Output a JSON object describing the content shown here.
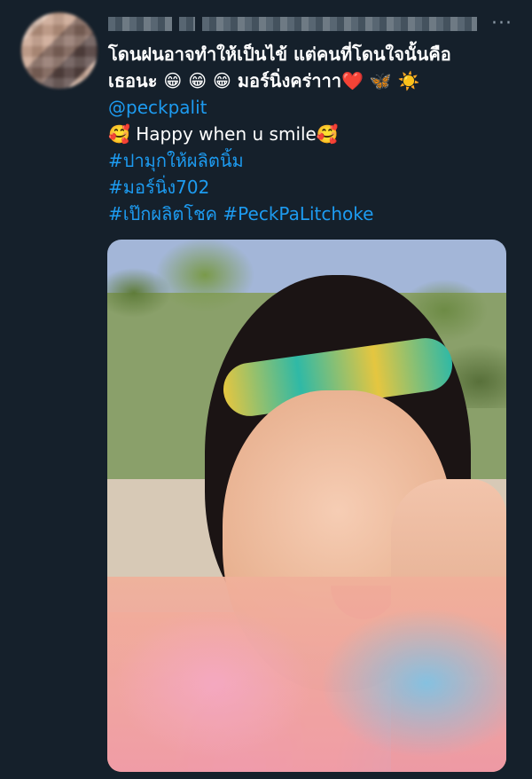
{
  "tweet": {
    "more": "···",
    "text": {
      "line1": "โดนฝนอาจทำให้เป็นไข้ แต่คนที่โดนใจนั้นคือ",
      "line2": "เธอนะ 😁 😁 😁 มอร์นิ่งคร่าาา❤️ 🦋 ☀️",
      "mention": "@peckpalit",
      "happy": "🥰 Happy when u smile🥰",
      "hashtag1": "#ปามุกให้ผลิตนิ้ม",
      "hashtag2": "#มอร์นิ่ง702",
      "hashtag3": "#เป๊กผลิตโชค #PeckPaLitchoke"
    }
  },
  "colors": {
    "background": "#15202b",
    "text": "#ffffff",
    "link": "#1d9bf0",
    "muted": "#8b98a5"
  }
}
